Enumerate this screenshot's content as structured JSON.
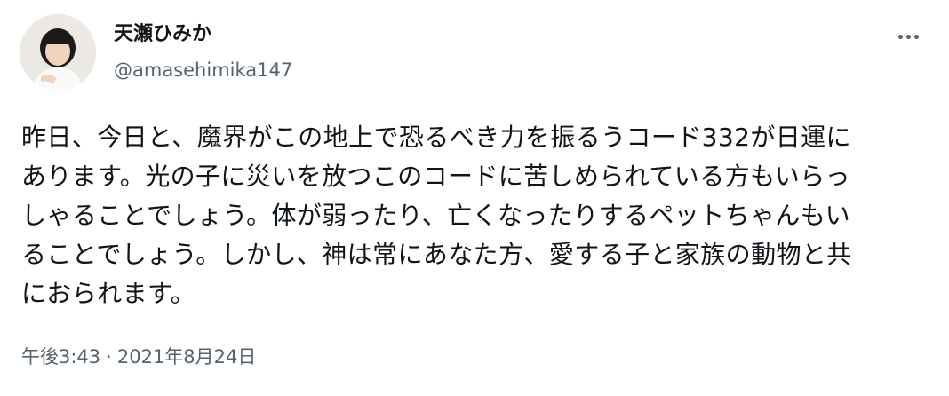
{
  "tweet": {
    "display_name": "天瀬ひみか",
    "handle": "@amasehimika147",
    "more_icon": "more-horizontal-icon",
    "avatar_icon": "user-avatar-photo",
    "text": "昨日、今日と、魔界がこの地上で恐るべき力を振るうコード332が日運に\nあります。光の子に災いを放つこのコードに苦しめられている方もいらっ\nしゃることでしょう。体が弱ったり、亡くなったりするペットちゃんもい\nることでしょう。しかし、神は常にあなた方、愛する子と家族の動物と共\nにおられます。",
    "time": "午後3:43",
    "separator": "·",
    "date": "2021年8月24日"
  },
  "colors": {
    "text_primary": "#0f1419",
    "text_secondary": "#536471",
    "background": "#ffffff"
  }
}
